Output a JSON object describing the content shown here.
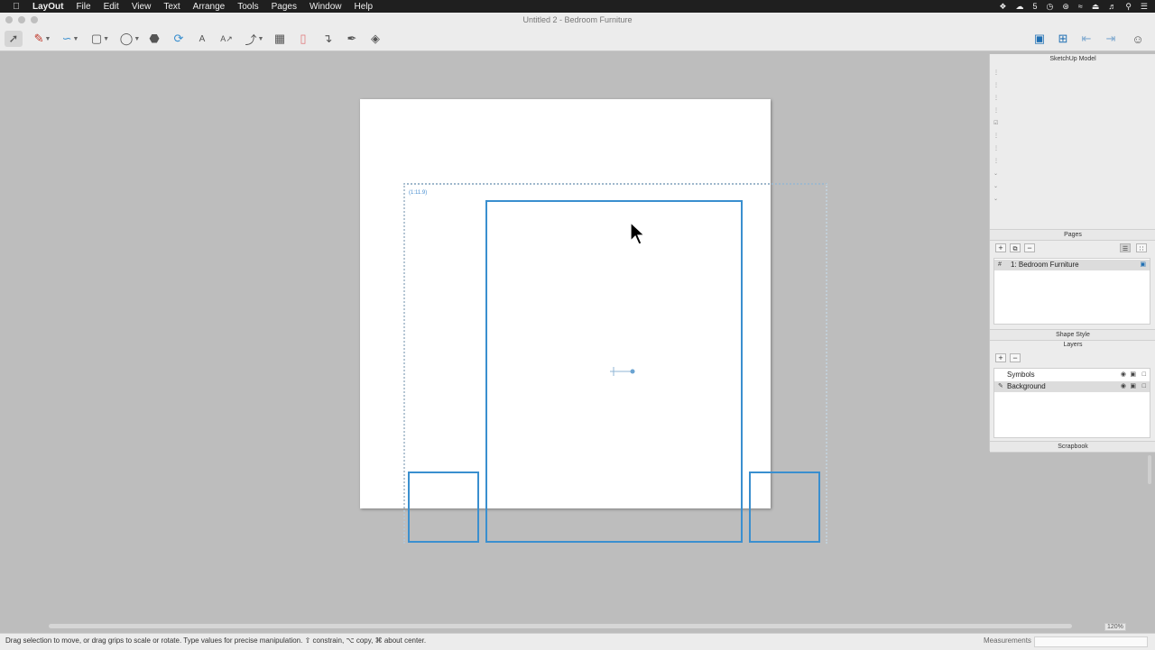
{
  "menubar": {
    "apple_icon": "apple-icon",
    "app_name": "LayOut",
    "menus": [
      "File",
      "Edit",
      "View",
      "Text",
      "Arrange",
      "Tools",
      "Pages",
      "Window",
      "Help"
    ],
    "status_badge": "5"
  },
  "window": {
    "title": "Untitled 2 - Bedroom Furniture"
  },
  "toolbar": {
    "tools": [
      "select-icon",
      "pencil-icon",
      "line-icon",
      "rectangle-icon",
      "circle-icon",
      "polygon-icon",
      "offset-icon",
      "text-icon",
      "label-icon",
      "dimension-icon",
      "table-icon",
      "eraser-icon",
      "eyedropper-icon",
      "paint-icon",
      "split-icon"
    ],
    "right_tools": [
      "present-icon",
      "add-page-icon",
      "previous-page-icon",
      "next-page-icon",
      "account-icon"
    ]
  },
  "canvas": {
    "viewport_scale_label": "(1:11.9)",
    "accent_color": "#3a8fcf"
  },
  "panels": {
    "sketchup_model": {
      "title": "SketchUp Model"
    },
    "pages": {
      "title": "Pages",
      "items": [
        {
          "number": "#",
          "label": "1:  Bedroom Furniture"
        }
      ]
    },
    "shape_style": {
      "title": "Shape Style"
    },
    "layers": {
      "title": "Layers",
      "items": [
        {
          "label": "Symbols",
          "active": false
        },
        {
          "label": "Background",
          "active": true
        }
      ]
    },
    "scrapbook": {
      "title": "Scrapbook"
    }
  },
  "status": {
    "message": "Drag selection to move, or drag grips to scale or rotate. Type values for precise manipulation. ⇧ constrain, ⌥ copy, ⌘ about center.",
    "measurements_label": "Measurements",
    "zoom": "120%"
  }
}
